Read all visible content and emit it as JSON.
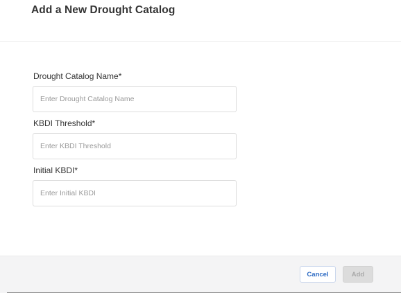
{
  "dialog": {
    "title": "Add a New Drought Catalog"
  },
  "form": {
    "fields": [
      {
        "label": "Drought Catalog Name*",
        "placeholder": "Enter Drought Catalog Name",
        "value": ""
      },
      {
        "label": "KBDI Threshold*",
        "placeholder": "Enter KBDI Threshold",
        "value": ""
      },
      {
        "label": "Initial KBDI*",
        "placeholder": "Enter Initial KBDI",
        "value": ""
      }
    ]
  },
  "footer": {
    "cancel_label": "Cancel",
    "add_label": "Add",
    "add_enabled": false
  },
  "colors": {
    "cancel_text": "#2f6cc4",
    "disabled_button_bg": "#dcdcdc",
    "footer_bg": "#f4f4f5"
  }
}
